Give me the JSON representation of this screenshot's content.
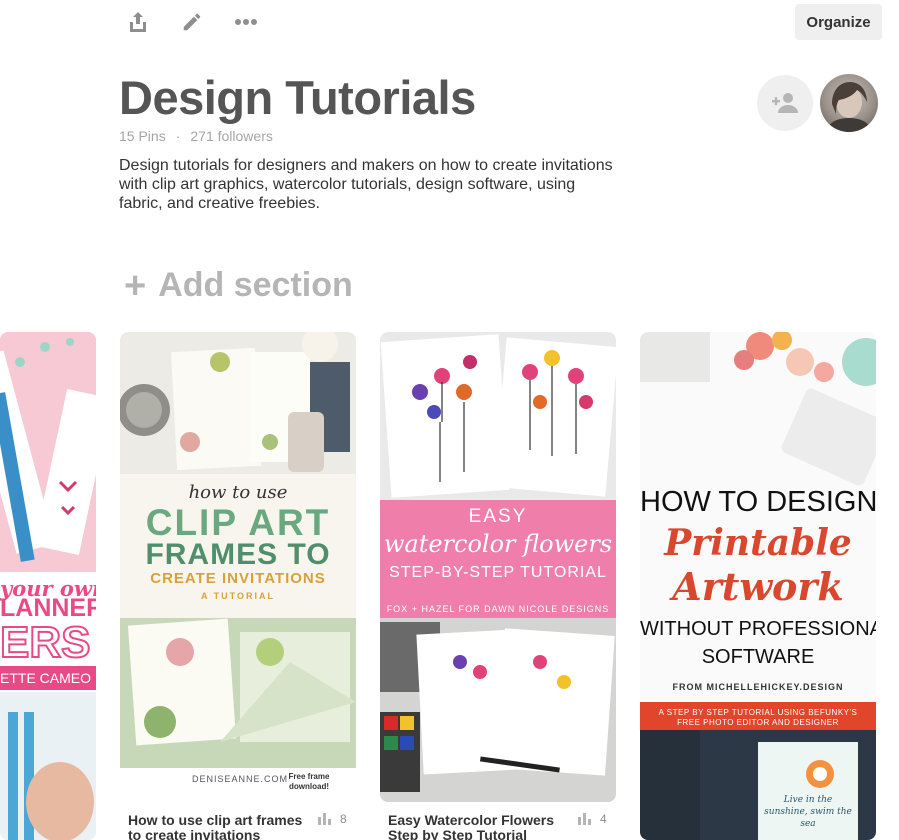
{
  "toolbar": {
    "organize_label": "Organize"
  },
  "board": {
    "title": "Design Tutorials",
    "pins_count": "15 Pins",
    "followers": "271 followers",
    "separator": "·",
    "description": "Design tutorials for designers and makers on how to create invitations with clip art graphics, watercolor tutorials, design software, using fabric, and creative freebies."
  },
  "add_section": {
    "plus": "+",
    "label": "Add section"
  },
  "pins": [
    {
      "image_text": {
        "line1": "your own",
        "line2": "LANNER",
        "line3": "ERS",
        "line4": "ETTE CAMEO"
      }
    },
    {
      "image_text": {
        "line1": "how to use",
        "line2": "CLIP ART",
        "line3": "FRAMES TO",
        "line4": "CREATE INVITATIONS",
        "line5": "A TUTORIAL",
        "footer_left": "DENISEANNE.COM",
        "footer_right": "Free frame download!"
      },
      "title": "How to use clip art frames to create invitations",
      "stat": "8"
    },
    {
      "image_text": {
        "line1": "EASY",
        "line2": "watercolor flowers",
        "line3": "STEP-BY-STEP TUTORIAL",
        "line4": "FOX + HAZEL FOR DAWN NICOLE DESIGNS"
      },
      "title": "Easy Watercolor Flowers Step by Step Tutorial",
      "stat": "4"
    },
    {
      "image_text": {
        "line1": "HOW TO DESIGN",
        "line2": "Printable",
        "line3": "Artwork",
        "line4": "WITHOUT PROFESSIONAL",
        "line5": "SOFTWARE",
        "line6": "FROM MICHELLEHICKEY.DESIGN",
        "line7": "A STEP BY STEP TUTORIAL USING BEFUNKY'S",
        "line8": "FREE PHOTO EDITOR AND DESIGNER",
        "quote": "Live in the sunshine, swim the sea"
      }
    }
  ],
  "colors": {
    "accent_green": "#5b9b73",
    "accent_gold": "#d6a23a",
    "pink_band": "#ef7eab",
    "red_script": "#d9482e",
    "red_band": "#e1452c"
  }
}
